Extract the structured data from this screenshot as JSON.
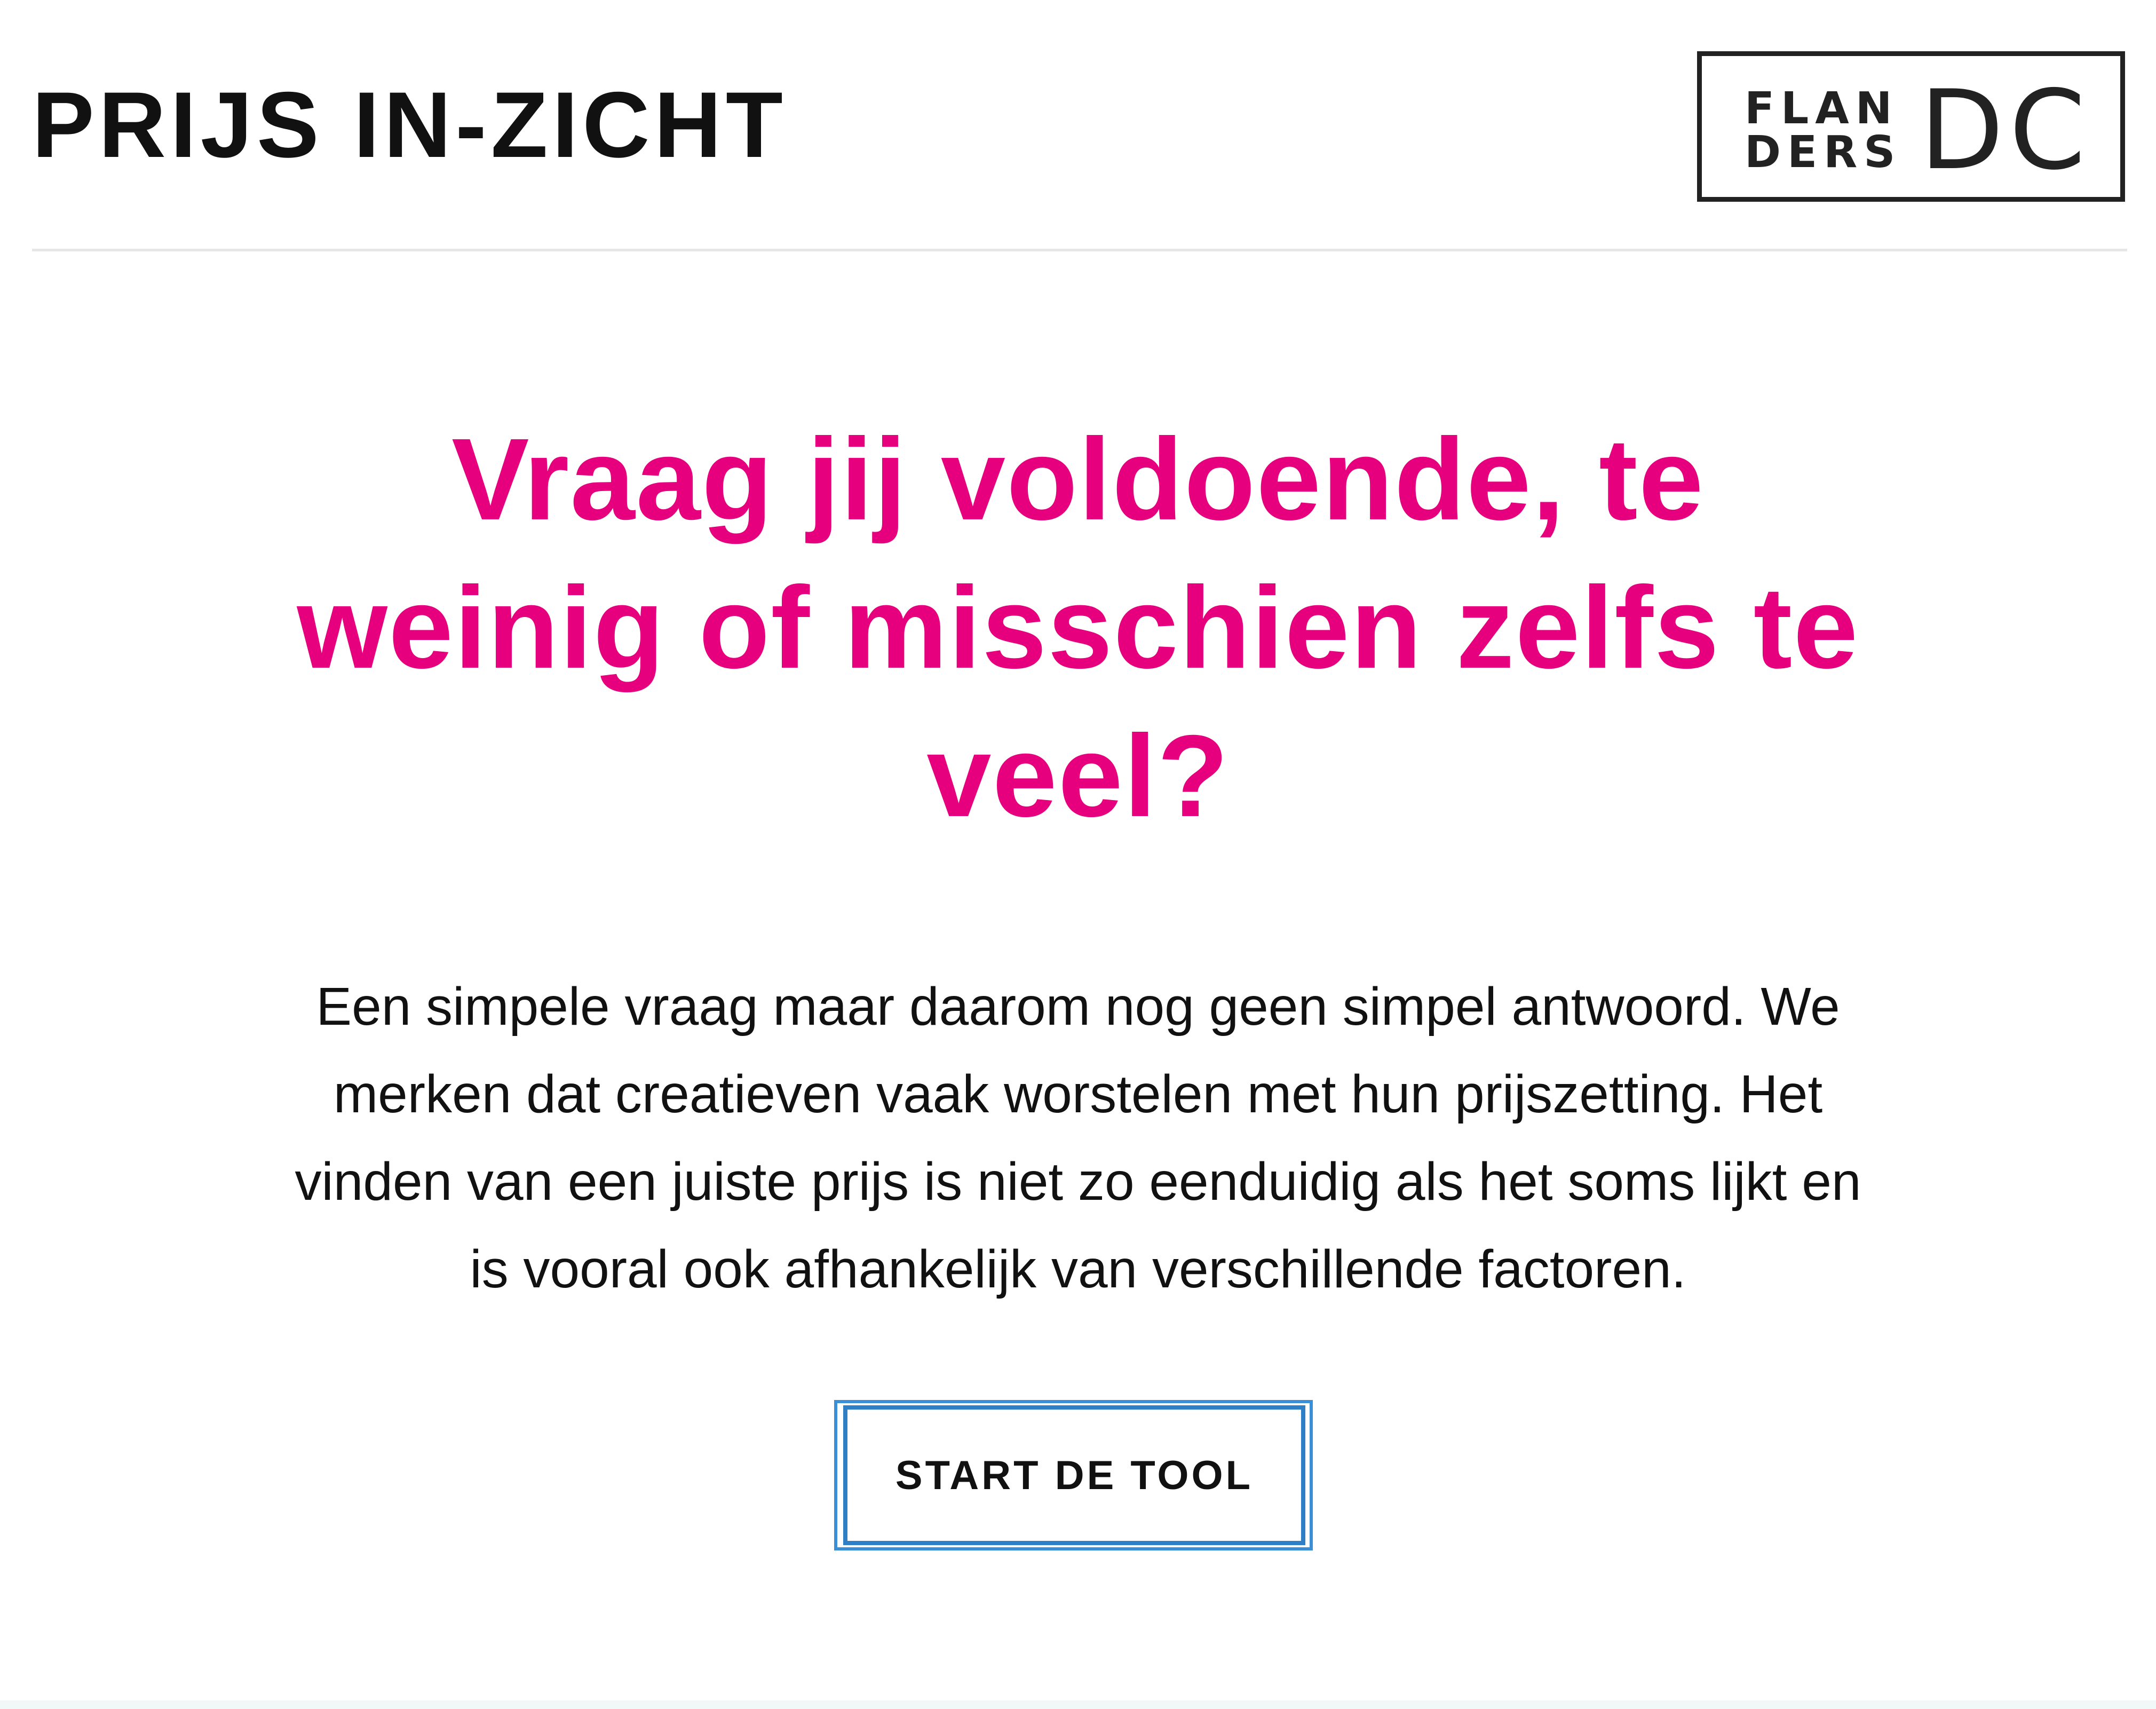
{
  "header": {
    "title": "PRIJS IN-ZICHT",
    "logo": {
      "line1": "FLAN",
      "line2": "DERS",
      "mark": "DC"
    }
  },
  "hero": {
    "headline": "Vraag jij voldoende, te weinig of misschien zelfs te veel?",
    "intro": "Een simpele vraag maar daarom nog geen simpel antwoord. We merken dat creatieven vaak worstelen met hun prijszetting. Het vinden van een juiste prijs is niet zo eenduidig als het soms lijkt en is vooral ook afhankelijk van verschillende factoren.",
    "cta_label": "START DE TOOL"
  },
  "colors": {
    "accent": "#e6007e",
    "focus_ring": "#3a8fd6",
    "text": "#111111",
    "divider": "#e6e6e6"
  }
}
